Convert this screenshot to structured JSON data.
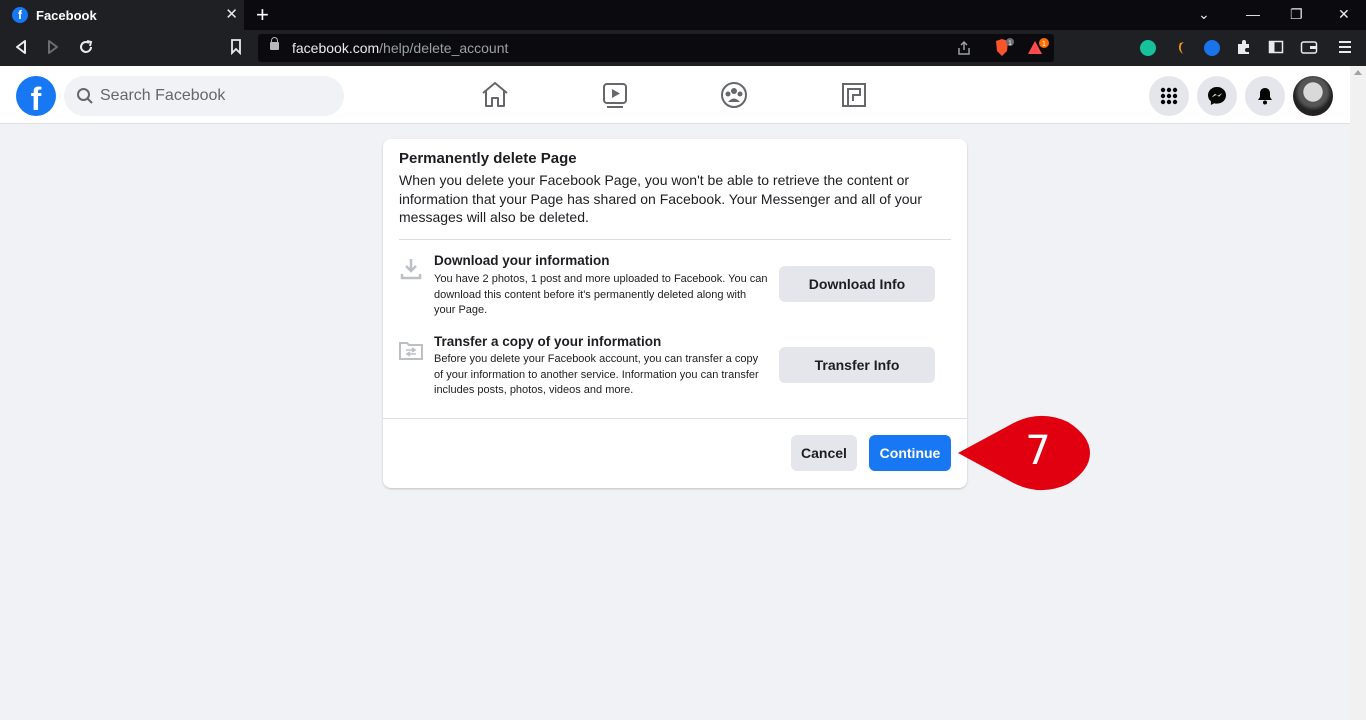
{
  "browser": {
    "tab_title": "Facebook",
    "tab_favicon_letter": "f",
    "url_host": "facebook.com",
    "url_path": "/help/delete_account",
    "brave_badge": "1",
    "alert_badge": "1"
  },
  "header": {
    "logo_letter": "f",
    "search_placeholder": "Search Facebook",
    "brand_color": "#1877f2"
  },
  "dialog": {
    "title": "Permanently delete Page",
    "description": "When you delete your Facebook Page, you won't be able to retrieve the content or information that your Page has shared on Facebook. Your Messenger and all of your messages will also be deleted.",
    "sections": [
      {
        "icon": "download-icon",
        "title": "Download your information",
        "text": "You have 2 photos, 1 post and more uploaded to Facebook. You can download this content before it's permanently deleted along with your Page.",
        "button": "Download Info"
      },
      {
        "icon": "transfer-folder-icon",
        "title": "Transfer a copy of your information",
        "text": "Before you delete your Facebook account, you can transfer a copy of your information to another service. Information you can transfer includes posts, photos, videos and more.",
        "button": "Transfer Info"
      }
    ],
    "cancel_label": "Cancel",
    "continue_label": "Continue"
  },
  "callout": {
    "step_number": "7",
    "color": "#e0000f"
  }
}
